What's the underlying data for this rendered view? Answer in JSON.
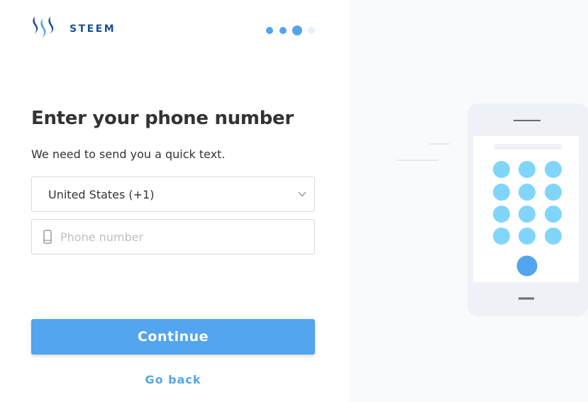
{
  "brand": {
    "name": "STEEM",
    "logo_icon": "steem-logo-icon",
    "logo_color": "#1a5099",
    "logo_accent": "#4ba2f2"
  },
  "progress": {
    "total_steps": 4,
    "current_step": 3
  },
  "form": {
    "heading": "Enter your phone number",
    "subtext": "We need to send you a quick text.",
    "country": {
      "selected": "United States (+1)"
    },
    "phone": {
      "placeholder": "Phone number",
      "value": ""
    },
    "continue_label": "Continue",
    "go_back_label": "Go back"
  },
  "illustration": {
    "description_icon": "phone-keypad-illustration"
  },
  "colors": {
    "accent": "#52a5ee",
    "text": "#333333",
    "keypad_key": "#82d5fa",
    "keypad_active": "#52a5ee",
    "panel_bg": "#f9fafb"
  }
}
